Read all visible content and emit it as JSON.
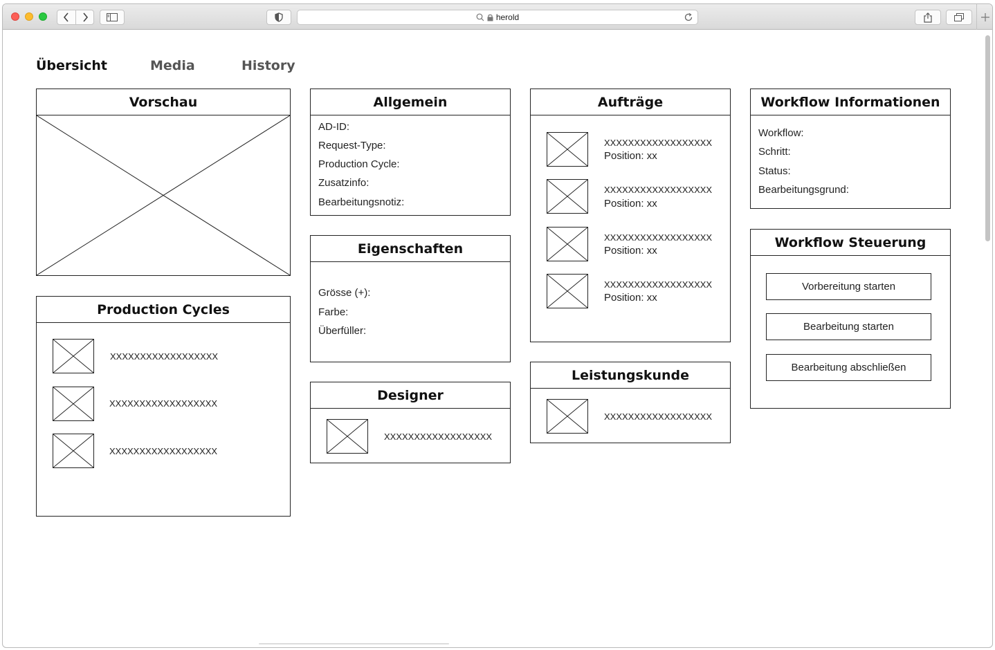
{
  "browser": {
    "url": "herold"
  },
  "tabs": [
    {
      "label": "Übersicht",
      "active": true
    },
    {
      "label": "Media",
      "active": false
    },
    {
      "label": "History",
      "active": false
    }
  ],
  "vorschau": {
    "title": "Vorschau"
  },
  "production_cycles": {
    "title": "Production Cycles",
    "items": [
      "XXXXXXXXXXXXXXXXXX",
      "XXXXXXXXXXXXXXXXXX",
      "XXXXXXXXXXXXXXXXXX"
    ]
  },
  "allgemein": {
    "title": "Allgemein",
    "fields": [
      "AD-ID:",
      "Request-Type:",
      "Production Cycle:",
      "Zusatzinfo:",
      "Bearbeitungsnotiz:"
    ]
  },
  "eigenschaften": {
    "title": "Eigenschaften",
    "fields": [
      "Grösse (+):",
      "Farbe:",
      "Überfüller:"
    ]
  },
  "designer": {
    "title": "Designer",
    "item": "XXXXXXXXXXXXXXXXXX"
  },
  "auftraege": {
    "title": "Aufträge",
    "items": [
      {
        "name": "XXXXXXXXXXXXXXXXXX",
        "position": "Position: xx"
      },
      {
        "name": "XXXXXXXXXXXXXXXXXX",
        "position": "Position: xx"
      },
      {
        "name": "XXXXXXXXXXXXXXXXXX",
        "position": "Position: xx"
      },
      {
        "name": "XXXXXXXXXXXXXXXXXX",
        "position": "Position: xx"
      }
    ]
  },
  "leistungskunde": {
    "title": "Leistungskunde",
    "item": "XXXXXXXXXXXXXXXXXX"
  },
  "workflow_info": {
    "title": "Workflow Informationen",
    "fields": [
      "Workflow:",
      "Schritt:",
      "Status:",
      "Bearbeitungsgrund:"
    ]
  },
  "workflow_steuerung": {
    "title": "Workflow Steuerung",
    "buttons": [
      "Vorbereitung starten",
      "Bearbeitung starten",
      "Bearbeitung abschließen"
    ]
  }
}
